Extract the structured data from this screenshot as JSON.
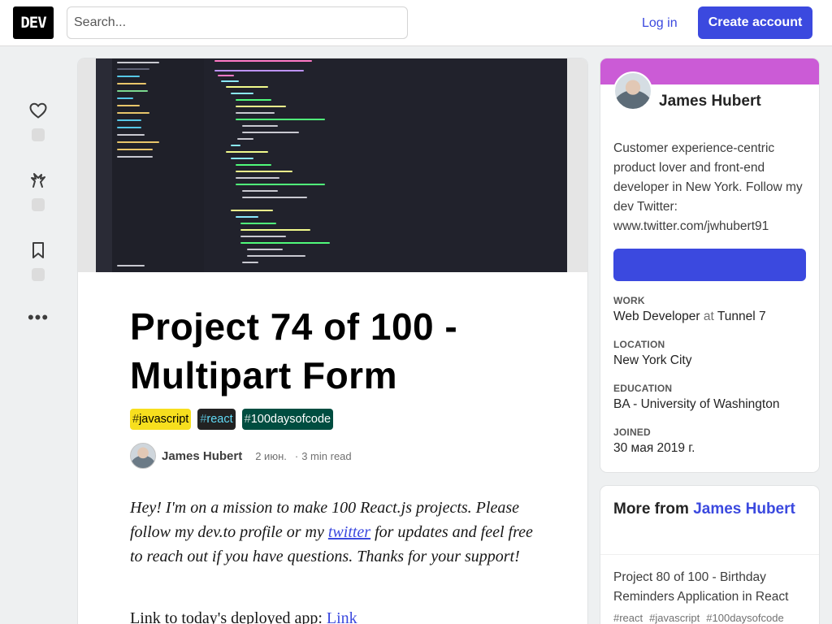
{
  "header": {
    "logo": "DEV",
    "search_placeholder": "Search...",
    "login_label": "Log in",
    "create_account_label": "Create account"
  },
  "reactions": {
    "icons": [
      "heart-icon",
      "unicorn-icon",
      "bookmark-icon",
      "more-icon"
    ],
    "more_label": "•••"
  },
  "article": {
    "title": "Project 74 of 100 - Multipart Form",
    "tags": [
      {
        "hash": "#",
        "name": "javascript",
        "bg": "#f7df1e",
        "fg": "#000000"
      },
      {
        "hash": "#",
        "name": "react",
        "bg": "#222222",
        "fg": "#61daf6"
      },
      {
        "hash": "#",
        "name": "100daysofcode",
        "bg": "#004d40",
        "fg": "#ffffff"
      }
    ],
    "author": "James Hubert",
    "date": "2 июн.",
    "separator": "·",
    "read_time": "3 min read",
    "body_before": "Hey! I'm on a mission to make 100 React.js projects. Please follow my dev.to profile or my ",
    "body_link": "twitter",
    "body_after": " for updates and feel free to reach out if you have questions. Thanks for your support!",
    "link_line_text": "Link to today's deployed app: ",
    "link_line_link": "Link"
  },
  "profile": {
    "name": "James Hubert",
    "bio": "Customer experience-centric product lover and front-end developer in New York. Follow my dev Twitter: www.twitter.com/jwhubert91",
    "work_label": "WORK",
    "work_role": "Web Developer",
    "work_at": "at",
    "work_company": "Tunnel 7",
    "location_label": "LOCATION",
    "location": "New York City",
    "education_label": "EDUCATION",
    "education": "BA - University of Washington",
    "joined_label": "JOINED",
    "joined": "30 мая 2019 г.",
    "brand_color": "#cb5bd6",
    "accent_color": "#3b49df"
  },
  "more_from": {
    "prefix": "More from",
    "author": "James Hubert",
    "item_title": "Project 80 of 100 - Birthday Reminders Application in React",
    "item_tags": [
      "#react",
      "#javascript",
      "#100daysofcode"
    ]
  }
}
